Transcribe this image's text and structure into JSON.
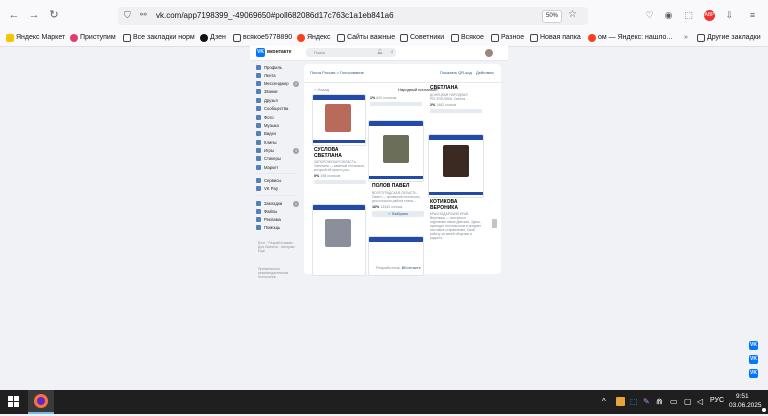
{
  "browser": {
    "url": "vk.com/app7198399_-49069650#poll682086d17c763c1a1eb841a6",
    "zoom": "50%",
    "bookmarks": [
      {
        "label": "Яндекс Маркет",
        "color": "#f7c600"
      },
      {
        "label": "Приступим",
        "color": "#e43b6d"
      },
      {
        "label": "Все закладки норм",
        "color": "#444"
      },
      {
        "label": "Дзен",
        "color": "#111"
      },
      {
        "label": "всякое5778890",
        "color": "#444"
      },
      {
        "label": "Яндекс",
        "color": "#fc3f1d"
      },
      {
        "label": "Сайты важные",
        "color": "#444"
      },
      {
        "label": "Советники",
        "color": "#444"
      },
      {
        "label": "Всякое",
        "color": "#444"
      },
      {
        "label": "Разное",
        "color": "#444"
      },
      {
        "label": "Новая папка",
        "color": "#444"
      },
      {
        "label": "ом — Яндекс: нашло...",
        "color": "#fc3f1d"
      },
      {
        "label": "Другие закладки",
        "color": "#444"
      }
    ]
  },
  "vk": {
    "logo_label": "вконтакте",
    "search_placeholder": "Поиск",
    "sidebar": [
      {
        "label": "Профиль",
        "badge": ""
      },
      {
        "label": "Лента",
        "badge": ""
      },
      {
        "label": "Мессенджер",
        "badge": "2"
      },
      {
        "label": "Звонки",
        "badge": ""
      },
      {
        "label": "Друзья",
        "badge": ""
      },
      {
        "label": "Сообщества",
        "badge": ""
      },
      {
        "label": "Фото",
        "badge": ""
      },
      {
        "label": "Музыка",
        "badge": ""
      },
      {
        "label": "Видео",
        "badge": ""
      },
      {
        "label": "Клипы",
        "badge": ""
      },
      {
        "label": "Игры",
        "badge": "4"
      },
      {
        "label": "Стикеры",
        "badge": ""
      },
      {
        "label": "Маркет",
        "badge": ""
      },
      {
        "label": "Сервисы",
        "badge": ""
      },
      {
        "label": "VK Pay",
        "badge": ""
      },
      {
        "label": "Закладки",
        "badge": "1"
      },
      {
        "label": "Файлы",
        "badge": ""
      },
      {
        "label": "Реклама",
        "badge": ""
      },
      {
        "label": "Помощь",
        "badge": ""
      }
    ],
    "footer_links": "Блог · Разработчикам · Для бизнеса · Авторам · Ещё",
    "footer_note": "Применяются рекомендательные технологии"
  },
  "app": {
    "breadcrumb": "Почта России > Голосование",
    "share_link": "Показать QR-код",
    "more_link": "Действия",
    "back_link": "< Назад",
    "board_title": "Народный почтальон",
    "footer_prefix": "Разработчик:",
    "footer_name": "ВКонтакте",
    "candidates": [
      {
        "name": "СУСЛОВА СВЕТЛАНА",
        "desc": "ЗАПОРОЖСКАЯ ОБЛАСТЬ. Светлана — заменый почтальон, который ей просто раз...",
        "percent": "0%",
        "votes": "198 голосов",
        "photo_color": "#b86b5a"
      },
      {
        "name": "ПОЛОВ ПАВЕЛ",
        "desc": "ВОЛГОГРАДСКАЯ ОБЛАСТЬ. Павел — нынешний почтальон, для которого работа стала...",
        "percent": "16%",
        "votes": "13342 голоса",
        "photo_color": "#6b6f5a",
        "vote_button": "✓ Выбрано"
      },
      {
        "name": "КОТИКОВА ВЕРОНИКА",
        "desc": "КРАСНОДАРСКИЙ КРАЙ. Вероника — почтальон отделения связи Динская. Здесь, приходит почтальоном и предает почтовые отправления. Свой работу за своей общение и радость",
        "percent": "",
        "votes": "",
        "photo_color": "#3b2a22"
      },
      {
        "name": "СВЕТЛАНА",
        "desc": "ДОНЕЦКАЯ НАРОДНАЯ РЕСПУБЛИКА. Светла...",
        "percent": "2%",
        "votes": "1482 голоса",
        "photo_color": "#9aa3b0"
      },
      {
        "name": "",
        "desc": "",
        "percent": "1%",
        "votes": "620 голосов",
        "photo_color": "#8a8f9b"
      }
    ]
  },
  "taskbar": {
    "lang": "РУС",
    "time": "9:51",
    "date": "03.06.2025"
  }
}
